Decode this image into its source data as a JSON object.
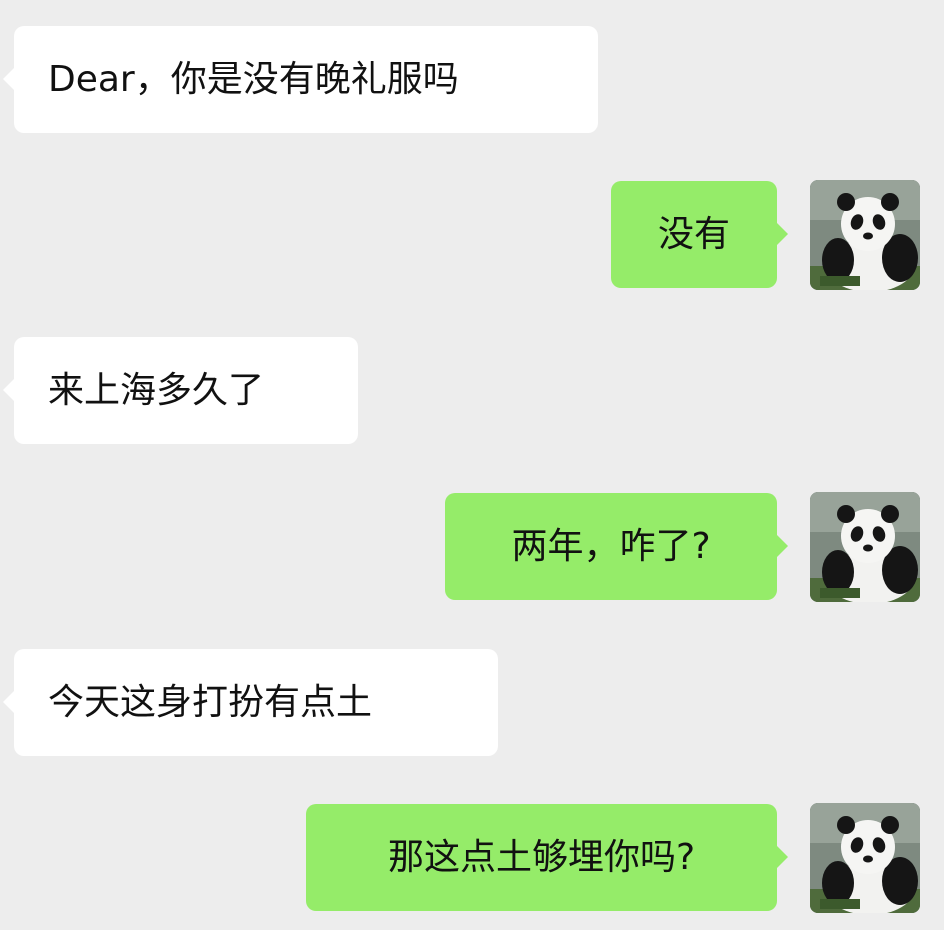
{
  "messages": [
    {
      "side": "in",
      "text": "Dear，你是没有晚礼服吗"
    },
    {
      "side": "out",
      "text": "没有"
    },
    {
      "side": "in",
      "text": "来上海多久了"
    },
    {
      "side": "out",
      "text": "两年，咋了?"
    },
    {
      "side": "in",
      "text": "今天这身打扮有点土"
    },
    {
      "side": "out",
      "text": "那这点土够埋你吗?"
    }
  ],
  "colors": {
    "background": "#ededed",
    "incoming_bubble": "#ffffff",
    "outgoing_bubble": "#95ec69"
  },
  "icons": {
    "self_avatar": "panda-avatar"
  }
}
